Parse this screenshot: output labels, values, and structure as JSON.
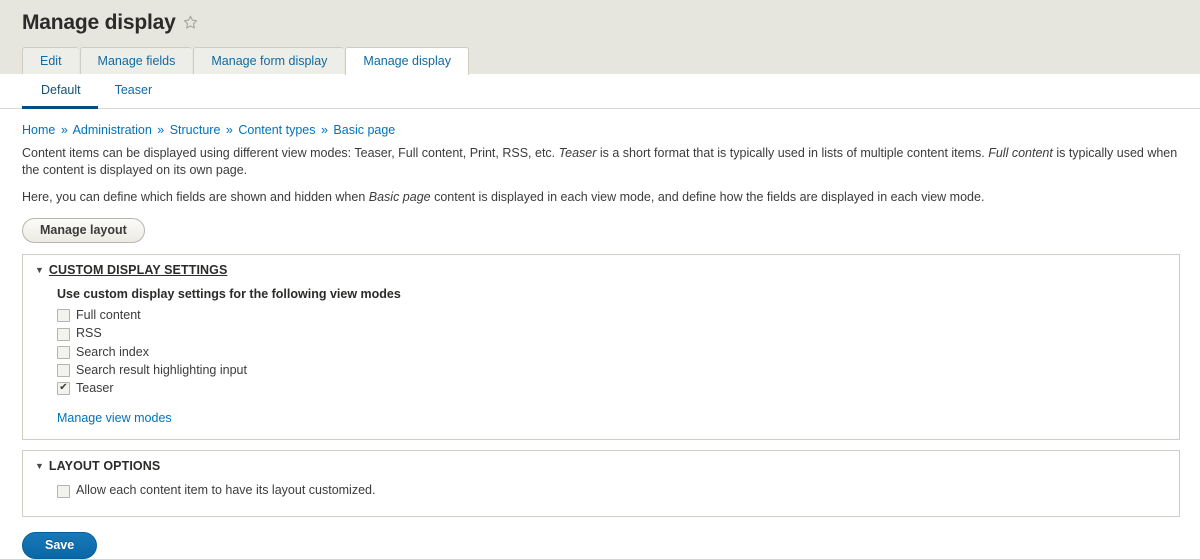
{
  "header": {
    "title": "Manage display",
    "star_icon": "star-outline-icon"
  },
  "primary_tabs": [
    {
      "label": "Edit",
      "active": false
    },
    {
      "label": "Manage fields",
      "active": false
    },
    {
      "label": "Manage form display",
      "active": false
    },
    {
      "label": "Manage display",
      "active": true
    }
  ],
  "secondary_tabs": [
    {
      "label": "Default",
      "active": true
    },
    {
      "label": "Teaser",
      "active": false
    }
  ],
  "breadcrumb": {
    "separator": "»",
    "items": [
      "Home",
      "Administration",
      "Structure",
      "Content types",
      "Basic page"
    ]
  },
  "intro": {
    "paragraph1_part1": "Content items can be displayed using different view modes: Teaser, Full content, Print, RSS, etc. ",
    "paragraph1_em1": "Teaser",
    "paragraph1_part2": " is a short format that is typically used in lists of multiple content items. ",
    "paragraph1_em2": "Full content",
    "paragraph1_part3": " is typically used when the content is displayed on its own page.",
    "paragraph2_part1": "Here, you can define which fields are shown and hidden when ",
    "paragraph2_em1": "Basic page",
    "paragraph2_part2": " content is displayed in each view mode, and define how the fields are displayed in each view mode."
  },
  "manage_layout_button": "Manage layout",
  "custom_display_settings": {
    "legend": "CUSTOM DISPLAY SETTINGS",
    "collapse_arrow": "▼",
    "sub_heading": "Use custom display settings for the following view modes",
    "checkboxes": [
      {
        "label": "Full content",
        "checked": false
      },
      {
        "label": "RSS",
        "checked": false
      },
      {
        "label": "Search index",
        "checked": false
      },
      {
        "label": "Search result highlighting input",
        "checked": false
      },
      {
        "label": "Teaser",
        "checked": true
      }
    ],
    "manage_view_modes_link": "Manage view modes"
  },
  "layout_options": {
    "legend": "LAYOUT OPTIONS",
    "collapse_arrow": "▼",
    "checkboxes": [
      {
        "label": "Allow each content item to have its layout customized.",
        "checked": false
      }
    ]
  },
  "save_button": "Save",
  "colors": {
    "header_bg": "#e6e5de",
    "link_blue": "#0073bb",
    "tab_blue": "#0f6aa3",
    "active_underline": "#004f80",
    "primary_button": "#0a67a6",
    "fieldset_border": "#ccccc4",
    "text": "#3b3b3b"
  }
}
